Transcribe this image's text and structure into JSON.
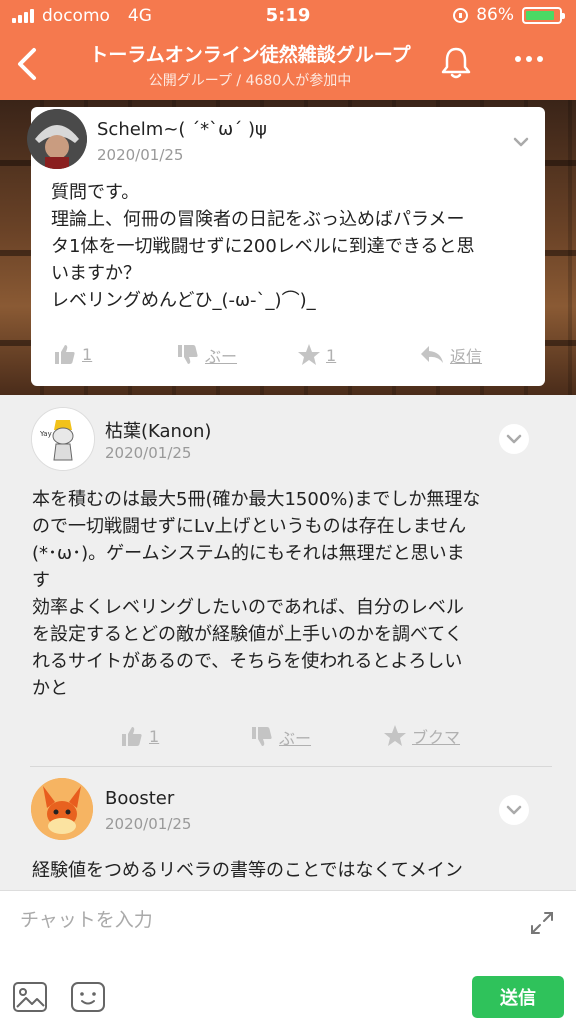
{
  "status": {
    "carrier": "docomo",
    "network": "4G",
    "time": "5:19",
    "battery": "86%",
    "battery_level": 0.86
  },
  "header": {
    "title": "トーラムオンライン徒然雑談グループ",
    "subtitle": "公開グループ / 4680人が参加中",
    "icons": [
      "back-arrow-icon",
      "bell-icon",
      "more-icon"
    ]
  },
  "posts": [
    {
      "author": "Schelm~( ´*`ω´ )ψ",
      "date": "2020/01/25",
      "body": "質問です。\n理論上、何冊の冒険者の日記をぶっ込めばパラメー\nタ1体を一切戦闘せずに200レベルに到達できると思\nいますか？\nレベリングめんどひ_(-ω-`_)⌒)_",
      "actions": {
        "like": "1",
        "boo": "ぶー",
        "star": "1",
        "reply": "返信"
      }
    },
    {
      "author": "枯葉(Kanon)",
      "date": "2020/01/25",
      "body": "本を積むのは最大5冊(確か最大1500%)までしか無理な\nので一切戦闘せずにLv上げというものは存在しません\n(*･ω･)。ゲームシステム的にもそれは無理だと思いま\nす\n効率よくレベリングしたいのであれば、自分のレベル\nを設定するとどの敵が経験値が上手いのかを調べてく\nれるサイトがあるので、そちらを使われるとよろしい\nかと",
      "actions": {
        "like": "1",
        "boo": "ぶー",
        "bookmark": "ブクマ"
      }
    },
    {
      "author": "Booster",
      "date": "2020/01/25",
      "body": "経験値をつめるリベラの書等のことではなくてメイン"
    }
  ],
  "input": {
    "placeholder": "チャットを入力",
    "send_label": "送信"
  },
  "colors": {
    "header": "#f5794e",
    "send": "#2fc25b"
  }
}
